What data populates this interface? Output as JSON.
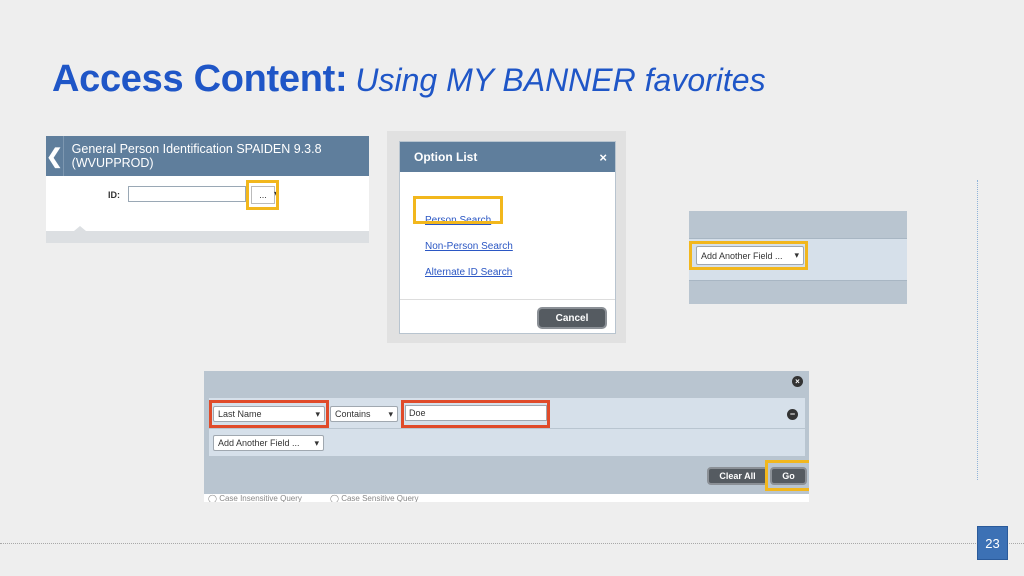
{
  "title": {
    "main": "Access Content:",
    "sub": "Using MY BANNER favorites"
  },
  "shot_spaiden": {
    "header_title": "General Person Identification SPAIDEN 9.3.8 (WVUPPROD)",
    "back_icon": "chevron-left-icon",
    "id_label": "ID:",
    "id_value": "",
    "lookup_button": "...",
    "dropdown_icon": "▾"
  },
  "shot_option_list": {
    "title": "Option List",
    "close": "×",
    "options": [
      "Person Search",
      "Non-Person Search",
      "Alternate ID Search"
    ],
    "cancel": "Cancel"
  },
  "shot_add_field": {
    "select_label": "Add Another Field ...",
    "arrow": "▾"
  },
  "shot_search": {
    "close": "×",
    "field_select": "Last Name",
    "operator_select": "Contains",
    "value": "Doe",
    "remove": "−",
    "add_field": "Add Another Field ...",
    "arrow": "▾",
    "clear_all": "Clear All",
    "go": "Go",
    "radio_insensitive": "Case Insensitive Query",
    "radio_sensitive": "Case Sensitive Query"
  },
  "page_number": "23",
  "colors": {
    "title": "#1f56c7",
    "banner_header": "#5f7e9c",
    "highlight_yellow": "#f2b71d",
    "highlight_red": "#e04b2a",
    "page_badge": "#3c71b5"
  }
}
